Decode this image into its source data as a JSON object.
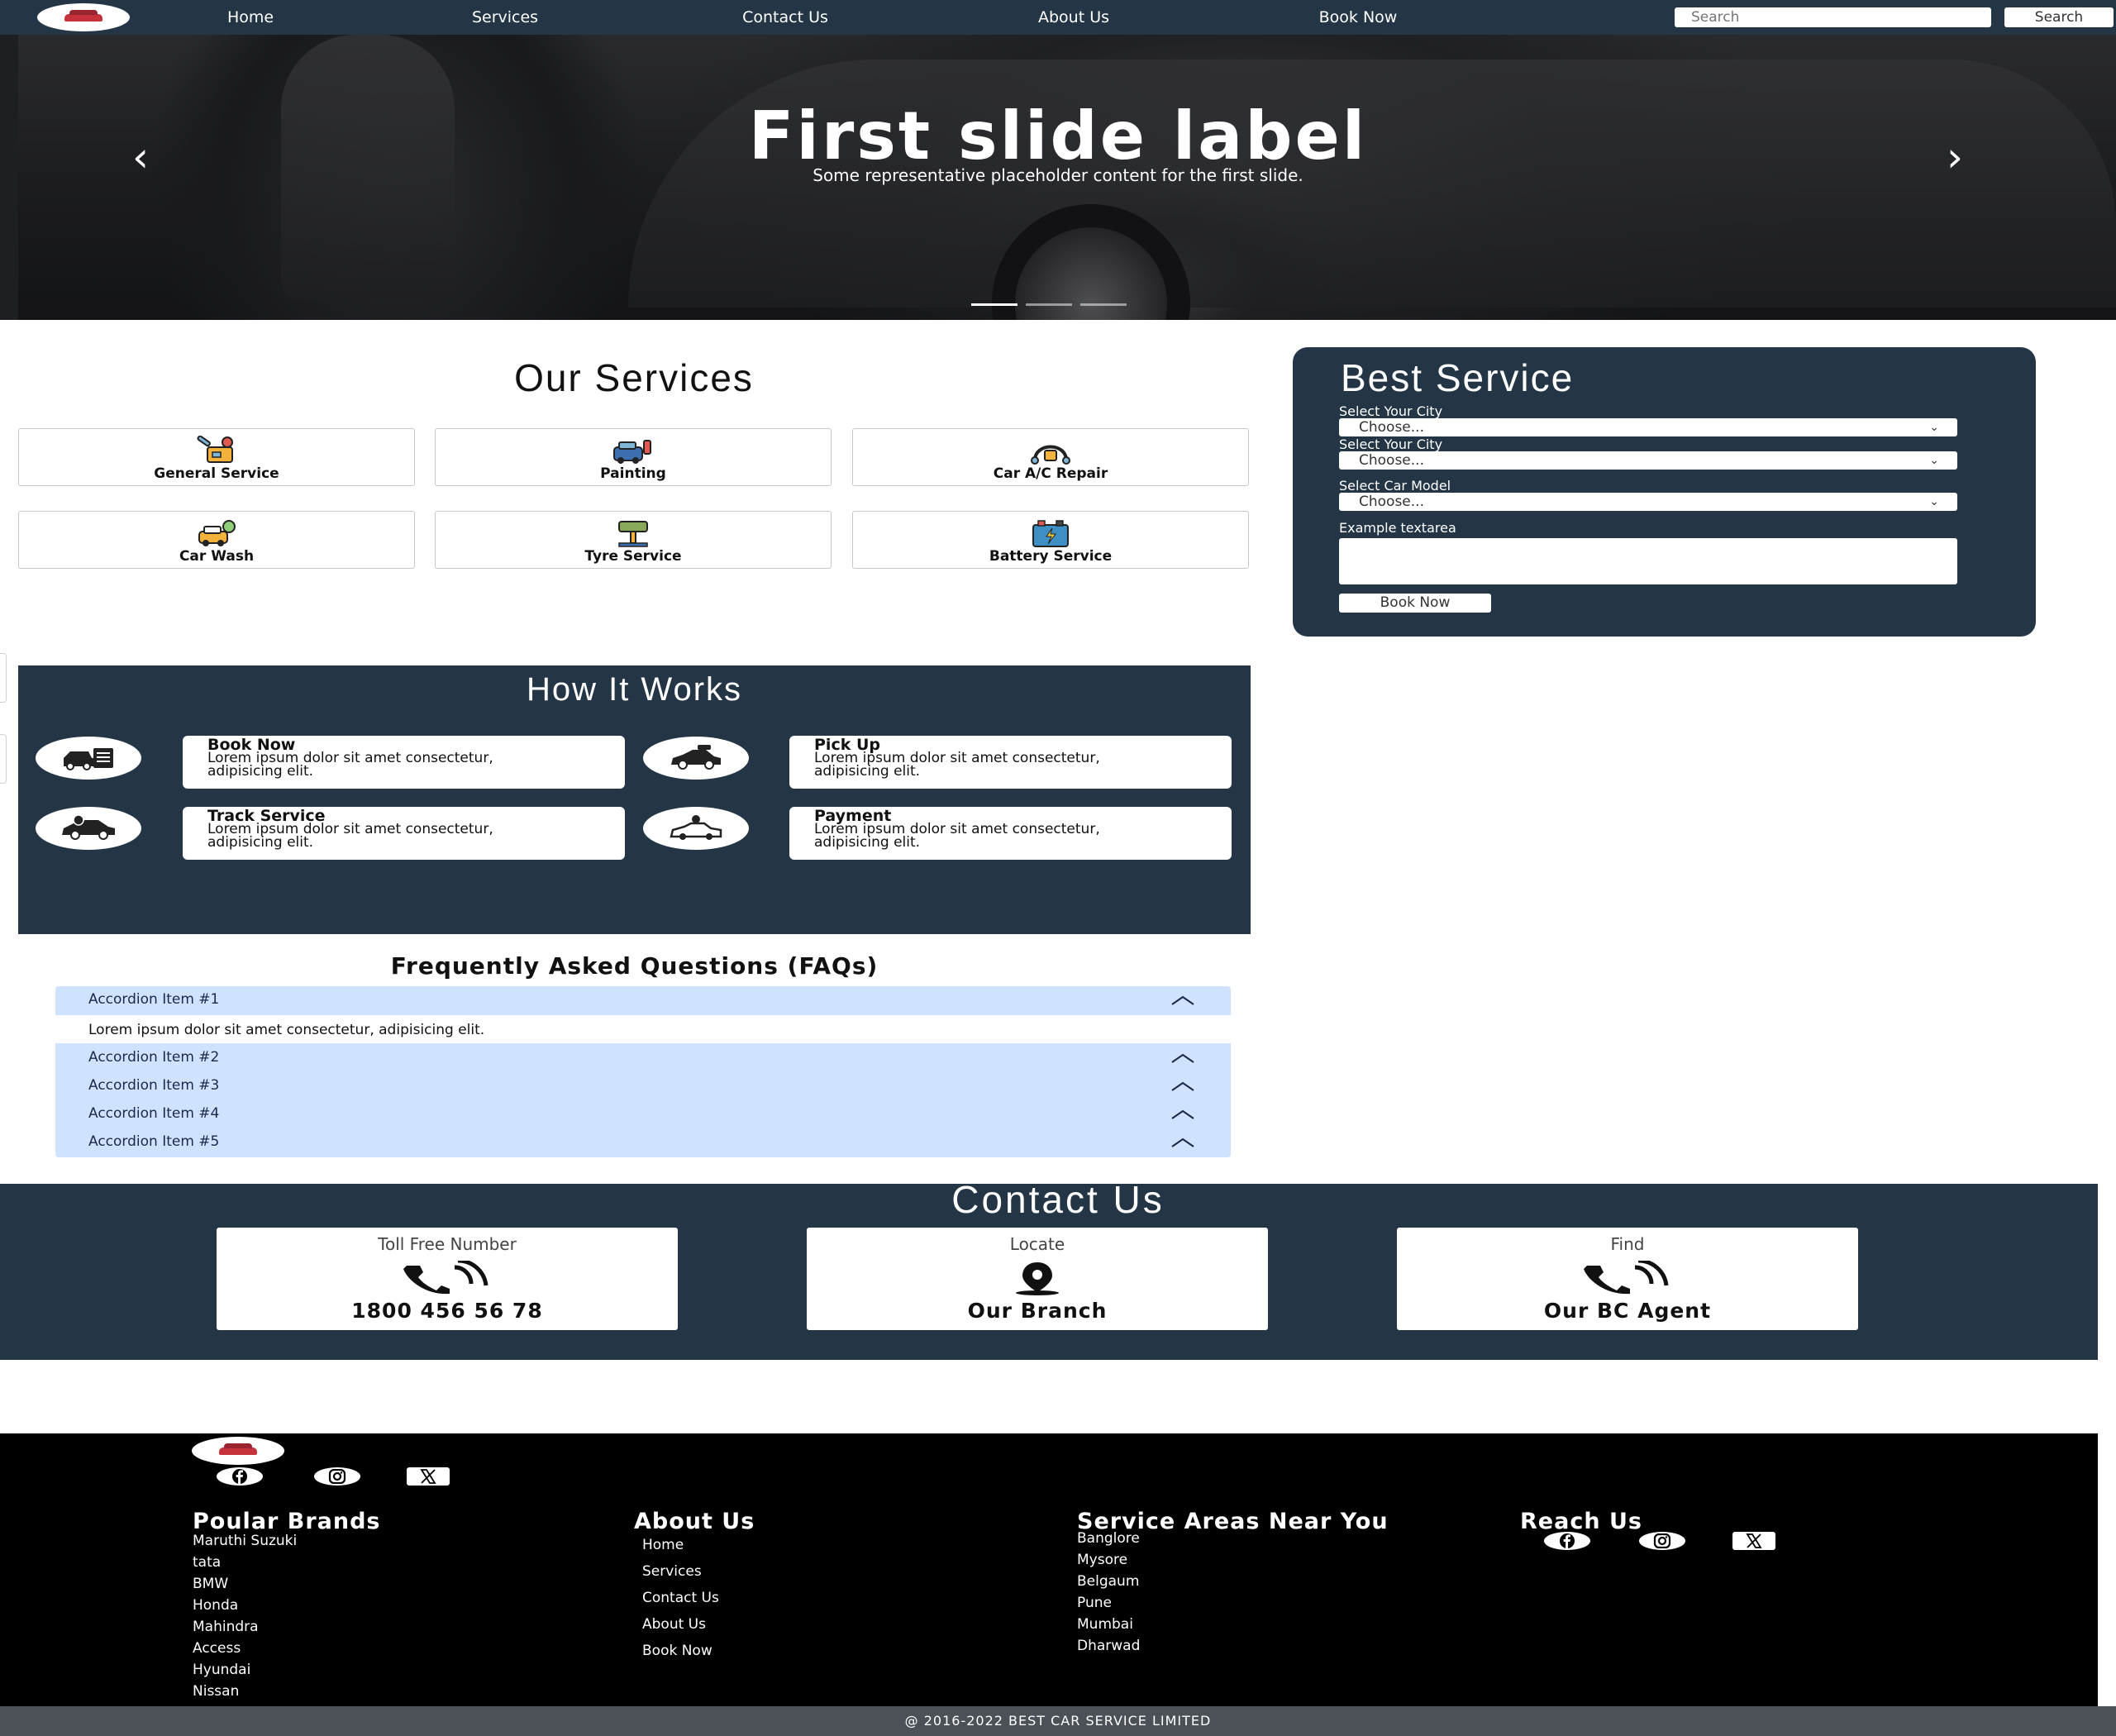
{
  "nav": {
    "links": [
      "Home",
      "Services",
      "Contact Us",
      "About Us",
      "Book Now"
    ],
    "search_placeholder": "Search",
    "search_button": "Search"
  },
  "hero": {
    "title": "First slide label",
    "caption": "Some representative placeholder content for the first slide.",
    "prev_icon": "chevron-left-icon",
    "next_icon": "chevron-right-icon",
    "slide_count": 3,
    "active_slide": 1
  },
  "services": {
    "title": "Our Services",
    "items": [
      {
        "label": "General Service",
        "icon": "tools-icon"
      },
      {
        "label": "Painting",
        "icon": "paint-spray-icon"
      },
      {
        "label": "Car A/C Repair",
        "icon": "ac-pipe-icon"
      },
      {
        "label": "Car Wash",
        "icon": "car-wash-icon"
      },
      {
        "label": "Tyre Service",
        "icon": "car-lift-icon"
      },
      {
        "label": "Battery Service",
        "icon": "battery-icon"
      }
    ]
  },
  "booking": {
    "title": "Best Service",
    "city_label_1": "Select Your City",
    "city_label_2": "Select Your City",
    "model_label": "Select Car Model",
    "select_placeholder": "Choose...",
    "textarea_label": "Example textarea",
    "submit": "Book Now"
  },
  "how_it_works": {
    "title": "How It Works",
    "steps": [
      {
        "title": "Book Now",
        "desc": "Lorem ipsum dolor sit amet consectetur, adipisicing elit.",
        "icon": "car-booking-icon"
      },
      {
        "title": "Pick Up",
        "desc": "Lorem ipsum dolor sit amet consectetur, adipisicing elit.",
        "icon": "car-pickup-icon"
      },
      {
        "title": "Track Service",
        "desc": "Lorem ipsum dolor sit amet consectetur, adipisicing elit.",
        "icon": "car-location-icon"
      },
      {
        "title": "Payment",
        "desc": "Lorem ipsum dolor sit amet consectetur, adipisicing elit.",
        "icon": "car-payment-icon"
      }
    ]
  },
  "faq": {
    "title": "Frequently Asked Questions (FAQs)",
    "items": [
      "Accordion Item #1",
      "Accordion Item #2",
      "Accordion Item #3",
      "Accordion Item #4",
      "Accordion Item #5"
    ],
    "open_body": "Lorem ipsum dolor sit amet consectetur, adipisicing elit."
  },
  "contact": {
    "title": "Contact Us",
    "cards": [
      {
        "head": "Toll Free Number",
        "value": "1800 456 56 78",
        "icon": "phone-icon"
      },
      {
        "head": "Locate",
        "value": "Our Branch",
        "icon": "map-pin-icon"
      },
      {
        "head": "Find",
        "value": "Our BC Agent",
        "icon": "phone-icon"
      }
    ]
  },
  "footer": {
    "brands_title": "Poular Brands",
    "brands": [
      "Maruthi Suzuki",
      "tata",
      "BMW",
      "Honda",
      "Mahindra",
      "Access",
      "Hyundai",
      "Nissan"
    ],
    "about_title": "About Us",
    "about_links": [
      "Home",
      "Services",
      "Contact Us",
      "About Us",
      "Book Now"
    ],
    "areas_title": "Service Areas Near You",
    "areas": [
      "Banglore",
      "Mysore",
      "Belgaum",
      "Pune",
      "Mumbai",
      "Dharwad"
    ],
    "reach_title": "Reach Us",
    "social_icons": [
      "facebook-icon",
      "instagram-icon",
      "x-icon"
    ],
    "copyright": "@ 2016-2022 BEST CAR SERVICE LIMITED"
  }
}
